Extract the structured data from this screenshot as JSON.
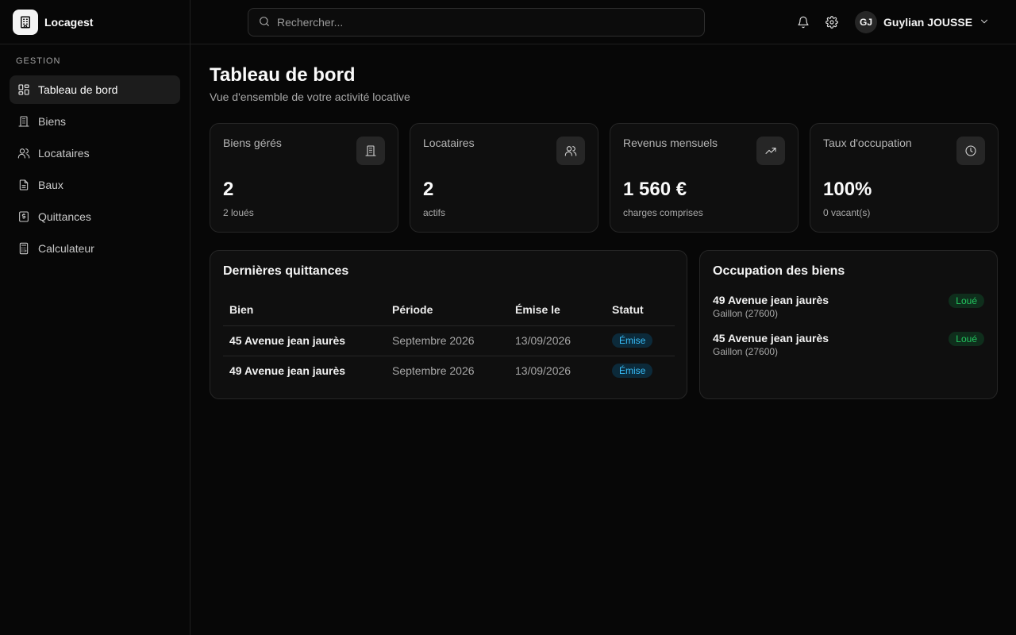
{
  "app": {
    "name": "Locagest"
  },
  "sidebar": {
    "section_label": "GESTION",
    "items": [
      {
        "label": "Tableau de bord",
        "icon": "dashboard-icon",
        "active": true
      },
      {
        "label": "Biens",
        "icon": "building-icon"
      },
      {
        "label": "Locataires",
        "icon": "users-icon"
      },
      {
        "label": "Baux",
        "icon": "file-icon"
      },
      {
        "label": "Quittances",
        "icon": "receipt-icon"
      },
      {
        "label": "Calculateur",
        "icon": "calculator-icon"
      }
    ]
  },
  "header": {
    "search_placeholder": "Rechercher...",
    "user_initials": "GJ",
    "user_name": "Guylian JOUSSE"
  },
  "page": {
    "title": "Tableau de bord",
    "subtitle": "Vue d'ensemble de votre activité locative"
  },
  "stats": [
    {
      "title": "Biens gérés",
      "value": "2",
      "note": "2 loués",
      "icon": "building-icon"
    },
    {
      "title": "Locataires",
      "value": "2",
      "note": "actifs",
      "icon": "users-icon"
    },
    {
      "title": "Revenus mensuels",
      "value": "1 560 €",
      "note": "charges comprises",
      "icon": "trending-up-icon"
    },
    {
      "title": "Taux d'occupation",
      "value": "100%",
      "note": "0 vacant(s)",
      "icon": "clock-icon"
    }
  ],
  "receipts": {
    "title": "Dernières quittances",
    "columns": [
      "Bien",
      "Période",
      "Émise le",
      "Statut"
    ],
    "rows": [
      {
        "bien": "45 Avenue jean jaurès",
        "periode": "Septembre 2026",
        "emise": "13/09/2026",
        "statut": "Émise"
      },
      {
        "bien": "49 Avenue jean jaurès",
        "periode": "Septembre 2026",
        "emise": "13/09/2026",
        "statut": "Émise"
      }
    ]
  },
  "occupation": {
    "title": "Occupation des biens",
    "items": [
      {
        "name": "49 Avenue jean jaurès",
        "city": "Gaillon (27600)",
        "status": "Loué"
      },
      {
        "name": "45 Avenue jean jaurès",
        "city": "Gaillon (27600)",
        "status": "Loué"
      }
    ]
  },
  "colors": {
    "background": "#070707",
    "card": "#0f0f0f",
    "border": "#262626",
    "badge_blue": "#38bdf8",
    "badge_green": "#22c55e"
  }
}
